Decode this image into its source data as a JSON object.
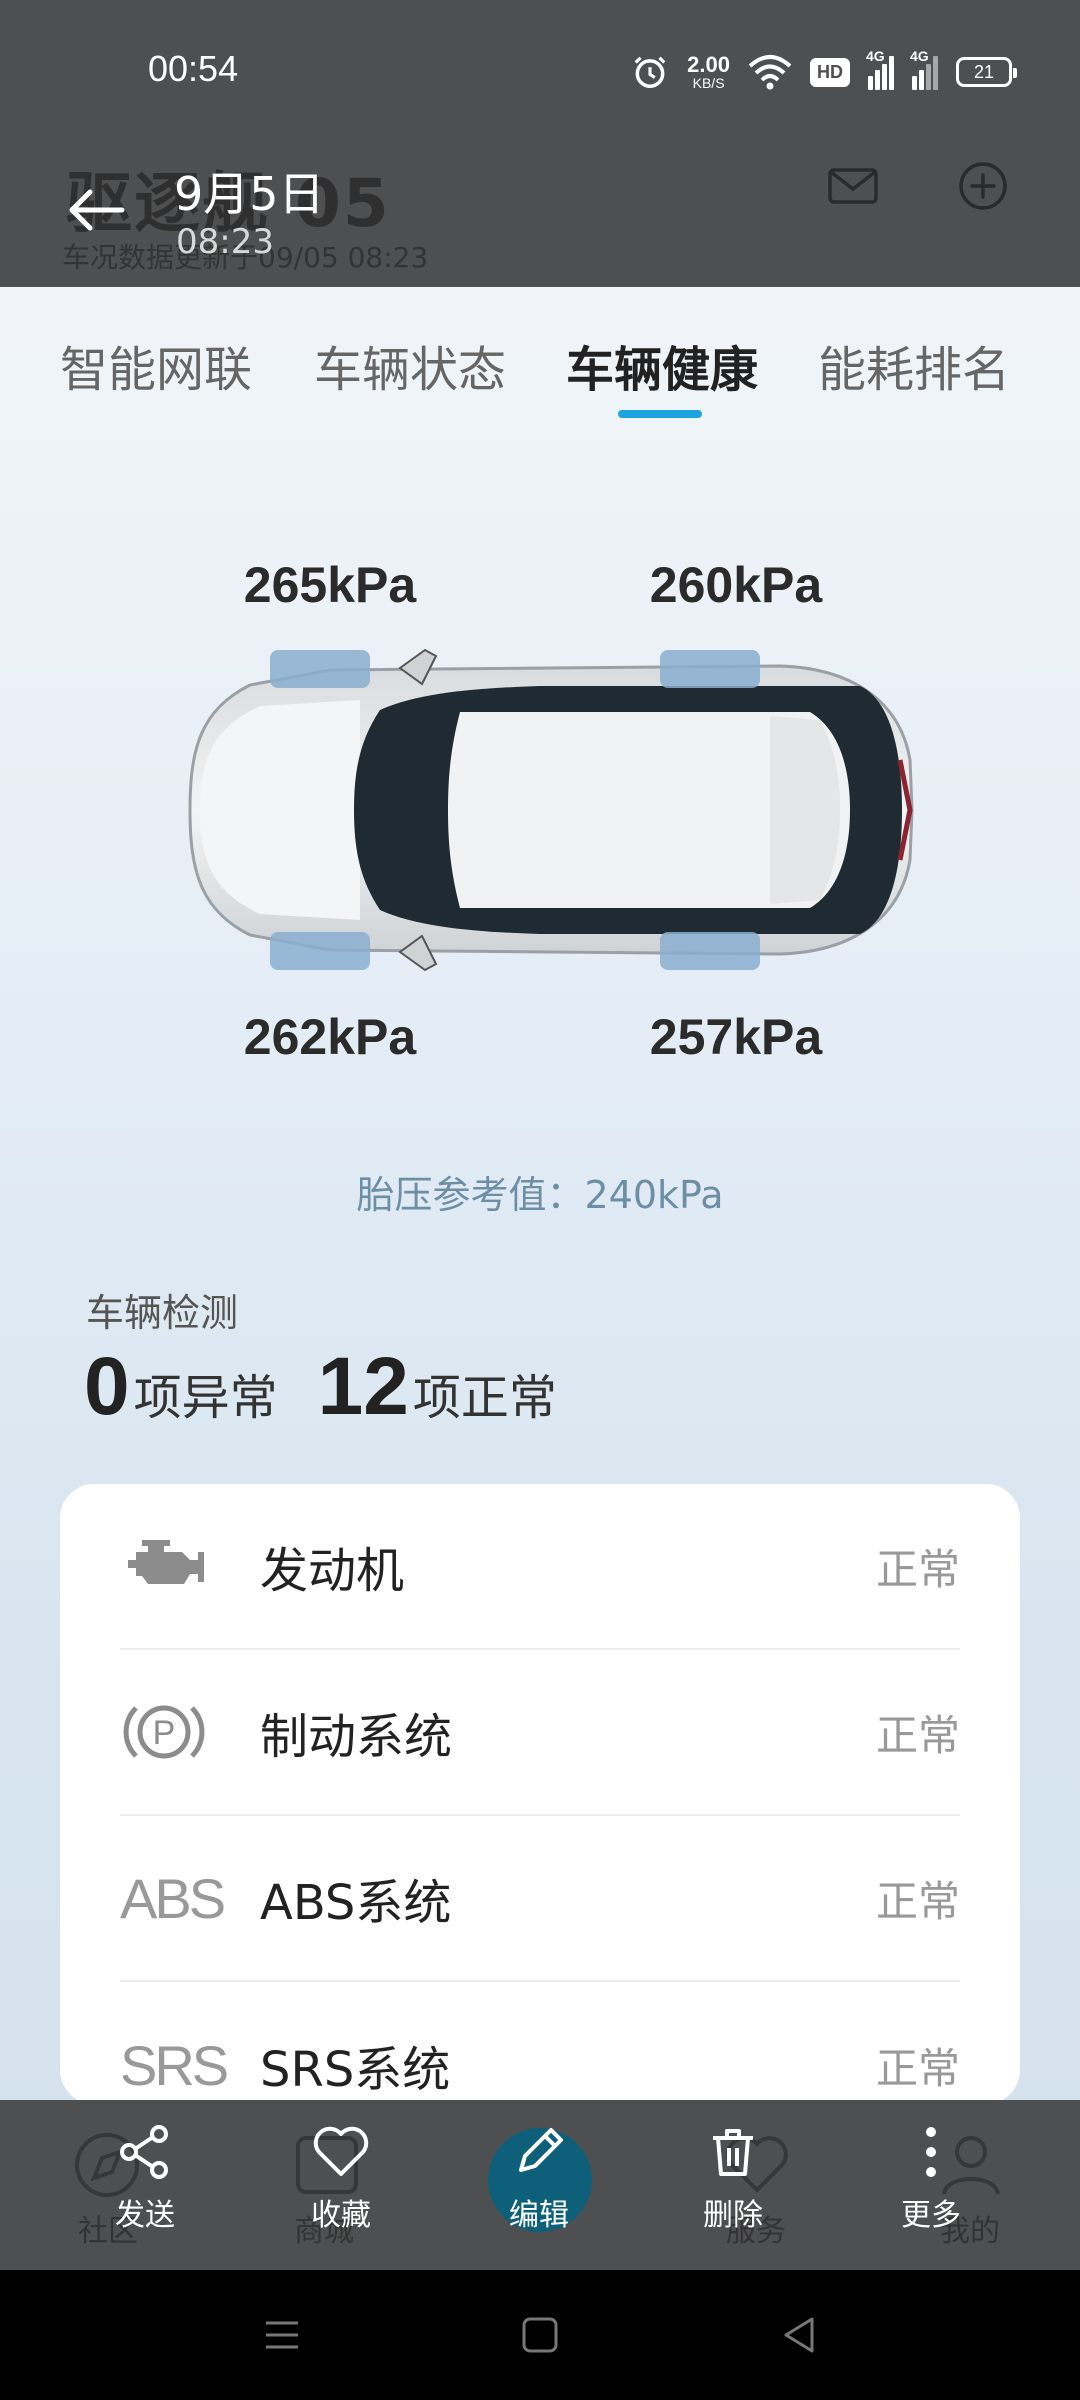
{
  "status_bar": {
    "time": "00:54",
    "net_speed_value": "2.00",
    "net_speed_unit": "KB/S",
    "hd_label": "HD",
    "signal1_label": "4G",
    "signal2_label": "4G",
    "battery": "21"
  },
  "app_header": {
    "title": "驱逐舰 05",
    "subtitle": "车况数据更新于09/05 08:23"
  },
  "viewer_header": {
    "date": "9月5日",
    "time": "08:23"
  },
  "tabs": [
    {
      "label": "智能网联",
      "active": false
    },
    {
      "label": "车辆状态",
      "active": false
    },
    {
      "label": "车辆健康",
      "active": true
    },
    {
      "label": "能耗排名",
      "active": false
    }
  ],
  "tires": {
    "front_left": "265kPa",
    "front_right": "260kPa",
    "rear_left": "262kPa",
    "rear_right": "257kPa",
    "reference": "胎压参考值：240kPa"
  },
  "detection": {
    "section_label": "车辆检测",
    "abnormal_count": "0",
    "abnormal_text": "项异常",
    "normal_count": "12",
    "normal_text": "项正常",
    "items": [
      {
        "icon": "engine-icon",
        "name": "发动机",
        "status": "正常"
      },
      {
        "icon": "parking-brake-icon",
        "name": "制动系统",
        "status": "正常"
      },
      {
        "icon": "abs-icon",
        "icon_text": "ABS",
        "name": "ABS系统",
        "status": "正常"
      },
      {
        "icon": "srs-icon",
        "icon_text": "SRS",
        "name": "SRS系统",
        "status": "正常"
      }
    ]
  },
  "bottom_ghost_nav": {
    "items": [
      "社区",
      "商城",
      "服务",
      "我的"
    ]
  },
  "actions": [
    {
      "icon": "share-icon",
      "label": "发送"
    },
    {
      "icon": "heart-icon",
      "label": "收藏"
    },
    {
      "icon": "edit-icon",
      "label": "编辑"
    },
    {
      "icon": "trash-icon",
      "label": "删除"
    },
    {
      "icon": "more-icon",
      "label": "更多"
    }
  ],
  "colors": {
    "accent": "#1ca3e0",
    "overlay": "#4e4f50",
    "reference_text": "#6d8fa6"
  }
}
